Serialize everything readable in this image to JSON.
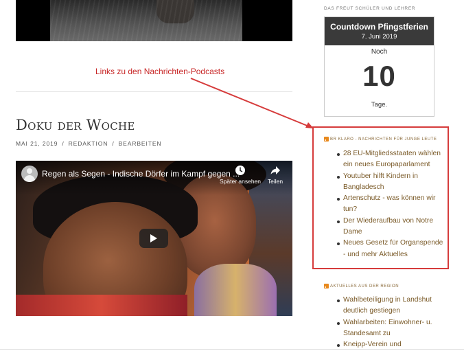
{
  "annotation": {
    "label": "Links zu den Nachrichten-Podcasts",
    "color": "#c82828"
  },
  "post": {
    "title": "Doku der Woche",
    "meta": {
      "date": "MAI 21, 2019",
      "author": "REDAKTION",
      "action": "BEARBEITEN"
    }
  },
  "video": {
    "title": "Regen als Segen - Indische Dörfer im Kampf gegen ...",
    "watch_later": "Später ansehen",
    "share": "Teilen"
  },
  "sidebar": {
    "heading": "DAS FREUT SCHÜLER UND LEHRER",
    "countdown": {
      "title": "Countdown Pfingstferien",
      "date": "7. Juni 2019",
      "pre": "Noch",
      "number": "10",
      "unit": "Tage."
    },
    "br_widget": {
      "heading": "BR KLARO - NACHRICHTEN FÜR JUNGE LEUTE",
      "items": [
        {
          "lines": [
            "28 EU-Mitgliedsstaaten wählen",
            "ein neues Europaparlament"
          ]
        },
        {
          "lines": [
            "Youtuber hilft Kindern in",
            "Bangladesch"
          ]
        },
        {
          "lines": [
            "Artenschutz - was können wir",
            "tun?"
          ]
        },
        {
          "lines": [
            "Der Wiederaufbau von Notre",
            "Dame"
          ]
        },
        {
          "lines": [
            "Neues Gesetz für Organspende",
            "- und mehr Aktuelles"
          ]
        }
      ],
      "highlight_color": "#d63b3b"
    },
    "region_widget": {
      "heading": "AKTUELLES AUS DER REGION",
      "items": [
        {
          "lines": [
            "Wahlbeteiligung in Landshut",
            "deutlich gestiegen"
          ]
        },
        {
          "lines": [
            "Wahlarbeiten: Einwohner- u.",
            "Standesamt zu"
          ]
        },
        {
          "lines": [
            "Kneipp-Verein und"
          ]
        }
      ]
    }
  },
  "icons": [
    "rss-icon",
    "clock-icon",
    "share-icon",
    "play-icon",
    "channel-avatar-icon"
  ]
}
